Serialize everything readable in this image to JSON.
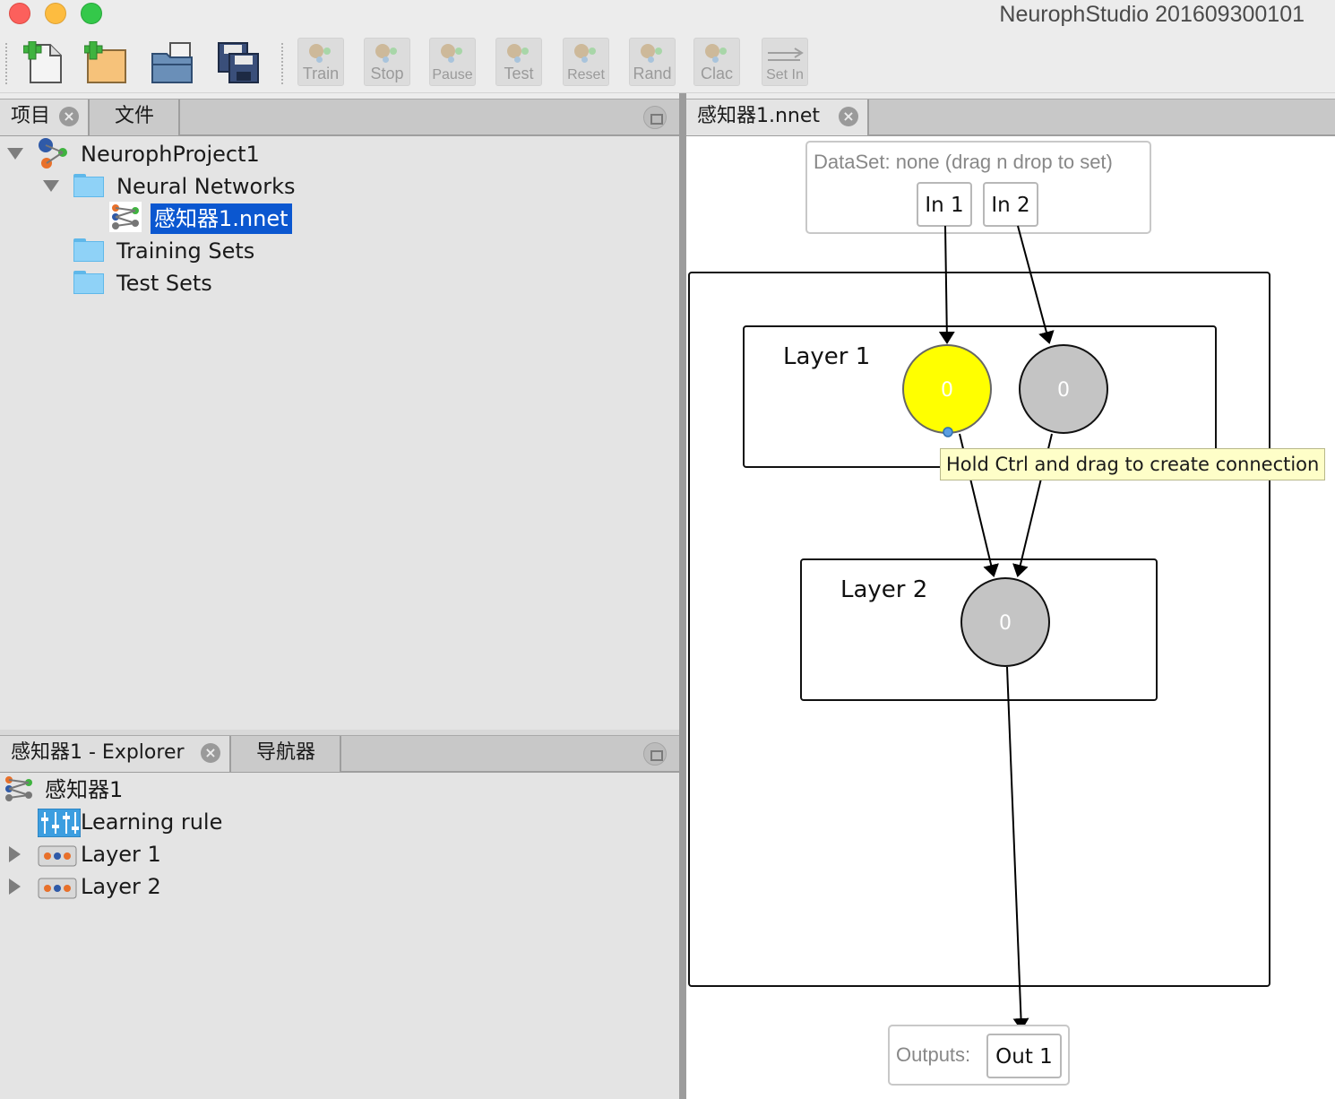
{
  "window": {
    "title": "NeurophStudio 201609300101"
  },
  "toolbar": {
    "buttons": [
      {
        "name": "new-project-icon"
      },
      {
        "name": "new-file-icon"
      },
      {
        "name": "open-project-icon"
      },
      {
        "name": "save-all-icon"
      }
    ],
    "training": [
      "Train",
      "Stop",
      "Pause",
      "Test",
      "Reset",
      "Rand",
      "Clac",
      "Set In"
    ]
  },
  "projects_panel": {
    "tabs": [
      {
        "label": "项目"
      },
      {
        "label": "文件"
      }
    ],
    "tree": {
      "project": "NeurophProject1",
      "neural_networks": "Neural Networks",
      "selected_file": "感知器1.nnet",
      "training_sets": "Training Sets",
      "test_sets": "Test Sets"
    }
  },
  "explorer_panel": {
    "tabs": [
      {
        "label": "感知器1 - Explorer"
      },
      {
        "label": "导航器"
      }
    ],
    "tree": {
      "network": "感知器1",
      "learning_rule": "Learning rule",
      "layer1": "Layer 1",
      "layer2": "Layer 2"
    }
  },
  "editor": {
    "tab": "感知器1.nnet",
    "dataset_label": "DataSet: none (drag n drop to set)",
    "inputs": [
      "In 1",
      "In 2"
    ],
    "layers": [
      {
        "label": "Layer 1",
        "neurons": [
          "0",
          "0"
        ]
      },
      {
        "label": "Layer 2",
        "neurons": [
          "0"
        ]
      }
    ],
    "tooltip": "Hold Ctrl and drag to create connection",
    "outputs_label": "Outputs:",
    "outputs": [
      "Out 1"
    ]
  },
  "colors": {
    "selection": "#0b57d0",
    "neuron_active": "#ffff00",
    "neuron_idle": "#c4c4c4",
    "tooltip_bg": "#fefec8"
  }
}
